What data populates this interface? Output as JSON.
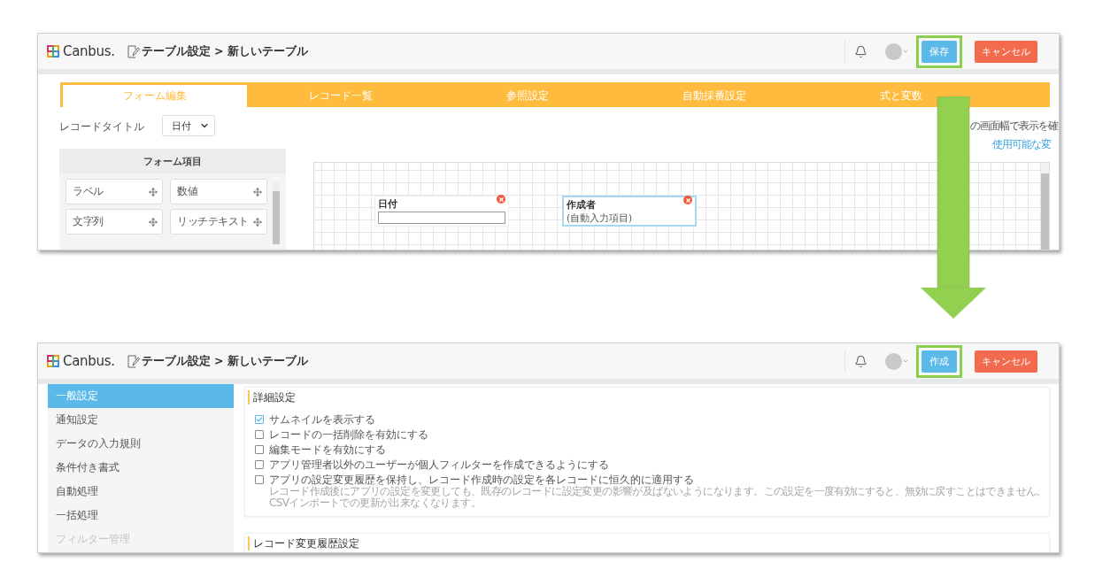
{
  "form_editor_screen": {
    "header": {
      "brand": "Canbus.",
      "breadcrumb": "テーブル設定 > 新しいテーブル",
      "buttons": [
        {
          "label": "保存",
          "kind": "primary",
          "highlighted": true
        },
        {
          "label": "キャンセル",
          "kind": "cancel",
          "highlighted": false
        }
      ]
    },
    "tabs": [
      {
        "label": "フォーム編集",
        "selected": true
      },
      {
        "label": "レコード一覧",
        "selected": false
      },
      {
        "label": "参照設定",
        "selected": false
      },
      {
        "label": "自動採番設定",
        "selected": false
      },
      {
        "label": "式と変数",
        "selected": false
      }
    ],
    "record_title": {
      "label": "レコードタイトル",
      "value": "日付"
    },
    "hint": "の画面幅で表示を確",
    "variables_link": "使用可能な変",
    "form_items": {
      "title": "フォーム項目",
      "items": [
        "ラベル",
        "数値",
        "文字列",
        "リッチテキスト"
      ]
    },
    "fields": [
      {
        "label": "日付",
        "kind": "input",
        "selected": false
      },
      {
        "label": "作成者",
        "kind": "auto",
        "value": "(自動入力項目)",
        "selected": true
      }
    ]
  },
  "settings_screen": {
    "header": {
      "brand": "Canbus.",
      "breadcrumb": "テーブル設定 > 新しいテーブル",
      "buttons": [
        {
          "label": "作成",
          "kind": "primary",
          "highlighted": true
        },
        {
          "label": "キャンセル",
          "kind": "cancel",
          "highlighted": false
        }
      ]
    },
    "sidebar": {
      "items": [
        {
          "label": "一般設定",
          "selected": true,
          "disabled": false
        },
        {
          "label": "通知設定",
          "selected": false,
          "disabled": false
        },
        {
          "label": "データの入力規則",
          "selected": false,
          "disabled": false
        },
        {
          "label": "条件付き書式",
          "selected": false,
          "disabled": false
        },
        {
          "label": "自動処理",
          "selected": false,
          "disabled": false
        },
        {
          "label": "一括処理",
          "selected": false,
          "disabled": false
        },
        {
          "label": "フィルター管理",
          "selected": false,
          "disabled": true
        }
      ]
    },
    "sections": [
      {
        "title": "詳細設定",
        "options": [
          {
            "label": "サムネイルを表示する",
            "checked": true
          },
          {
            "label": "レコードの一括削除を有効にする",
            "checked": false
          },
          {
            "label": "編集モードを有効にする",
            "checked": false
          },
          {
            "label": "アプリ管理者以外のユーザーが個人フィルターを作成できるようにする",
            "checked": false
          },
          {
            "label": "アプリの設定変更履歴を保持し、レコード作成時の設定を各レコードに恒久的に適用する",
            "checked": false,
            "notes": [
              "レコード作成後にアプリの設定を変更しても、既存のレコードに設定変更の影響が及ばないようになります。この設定を一度有効にすると、無効に戻すことはできません。",
              "CSVインポートでの更新が出来なくなります。"
            ]
          }
        ]
      },
      {
        "title": "レコード変更履歴設定"
      }
    ]
  }
}
